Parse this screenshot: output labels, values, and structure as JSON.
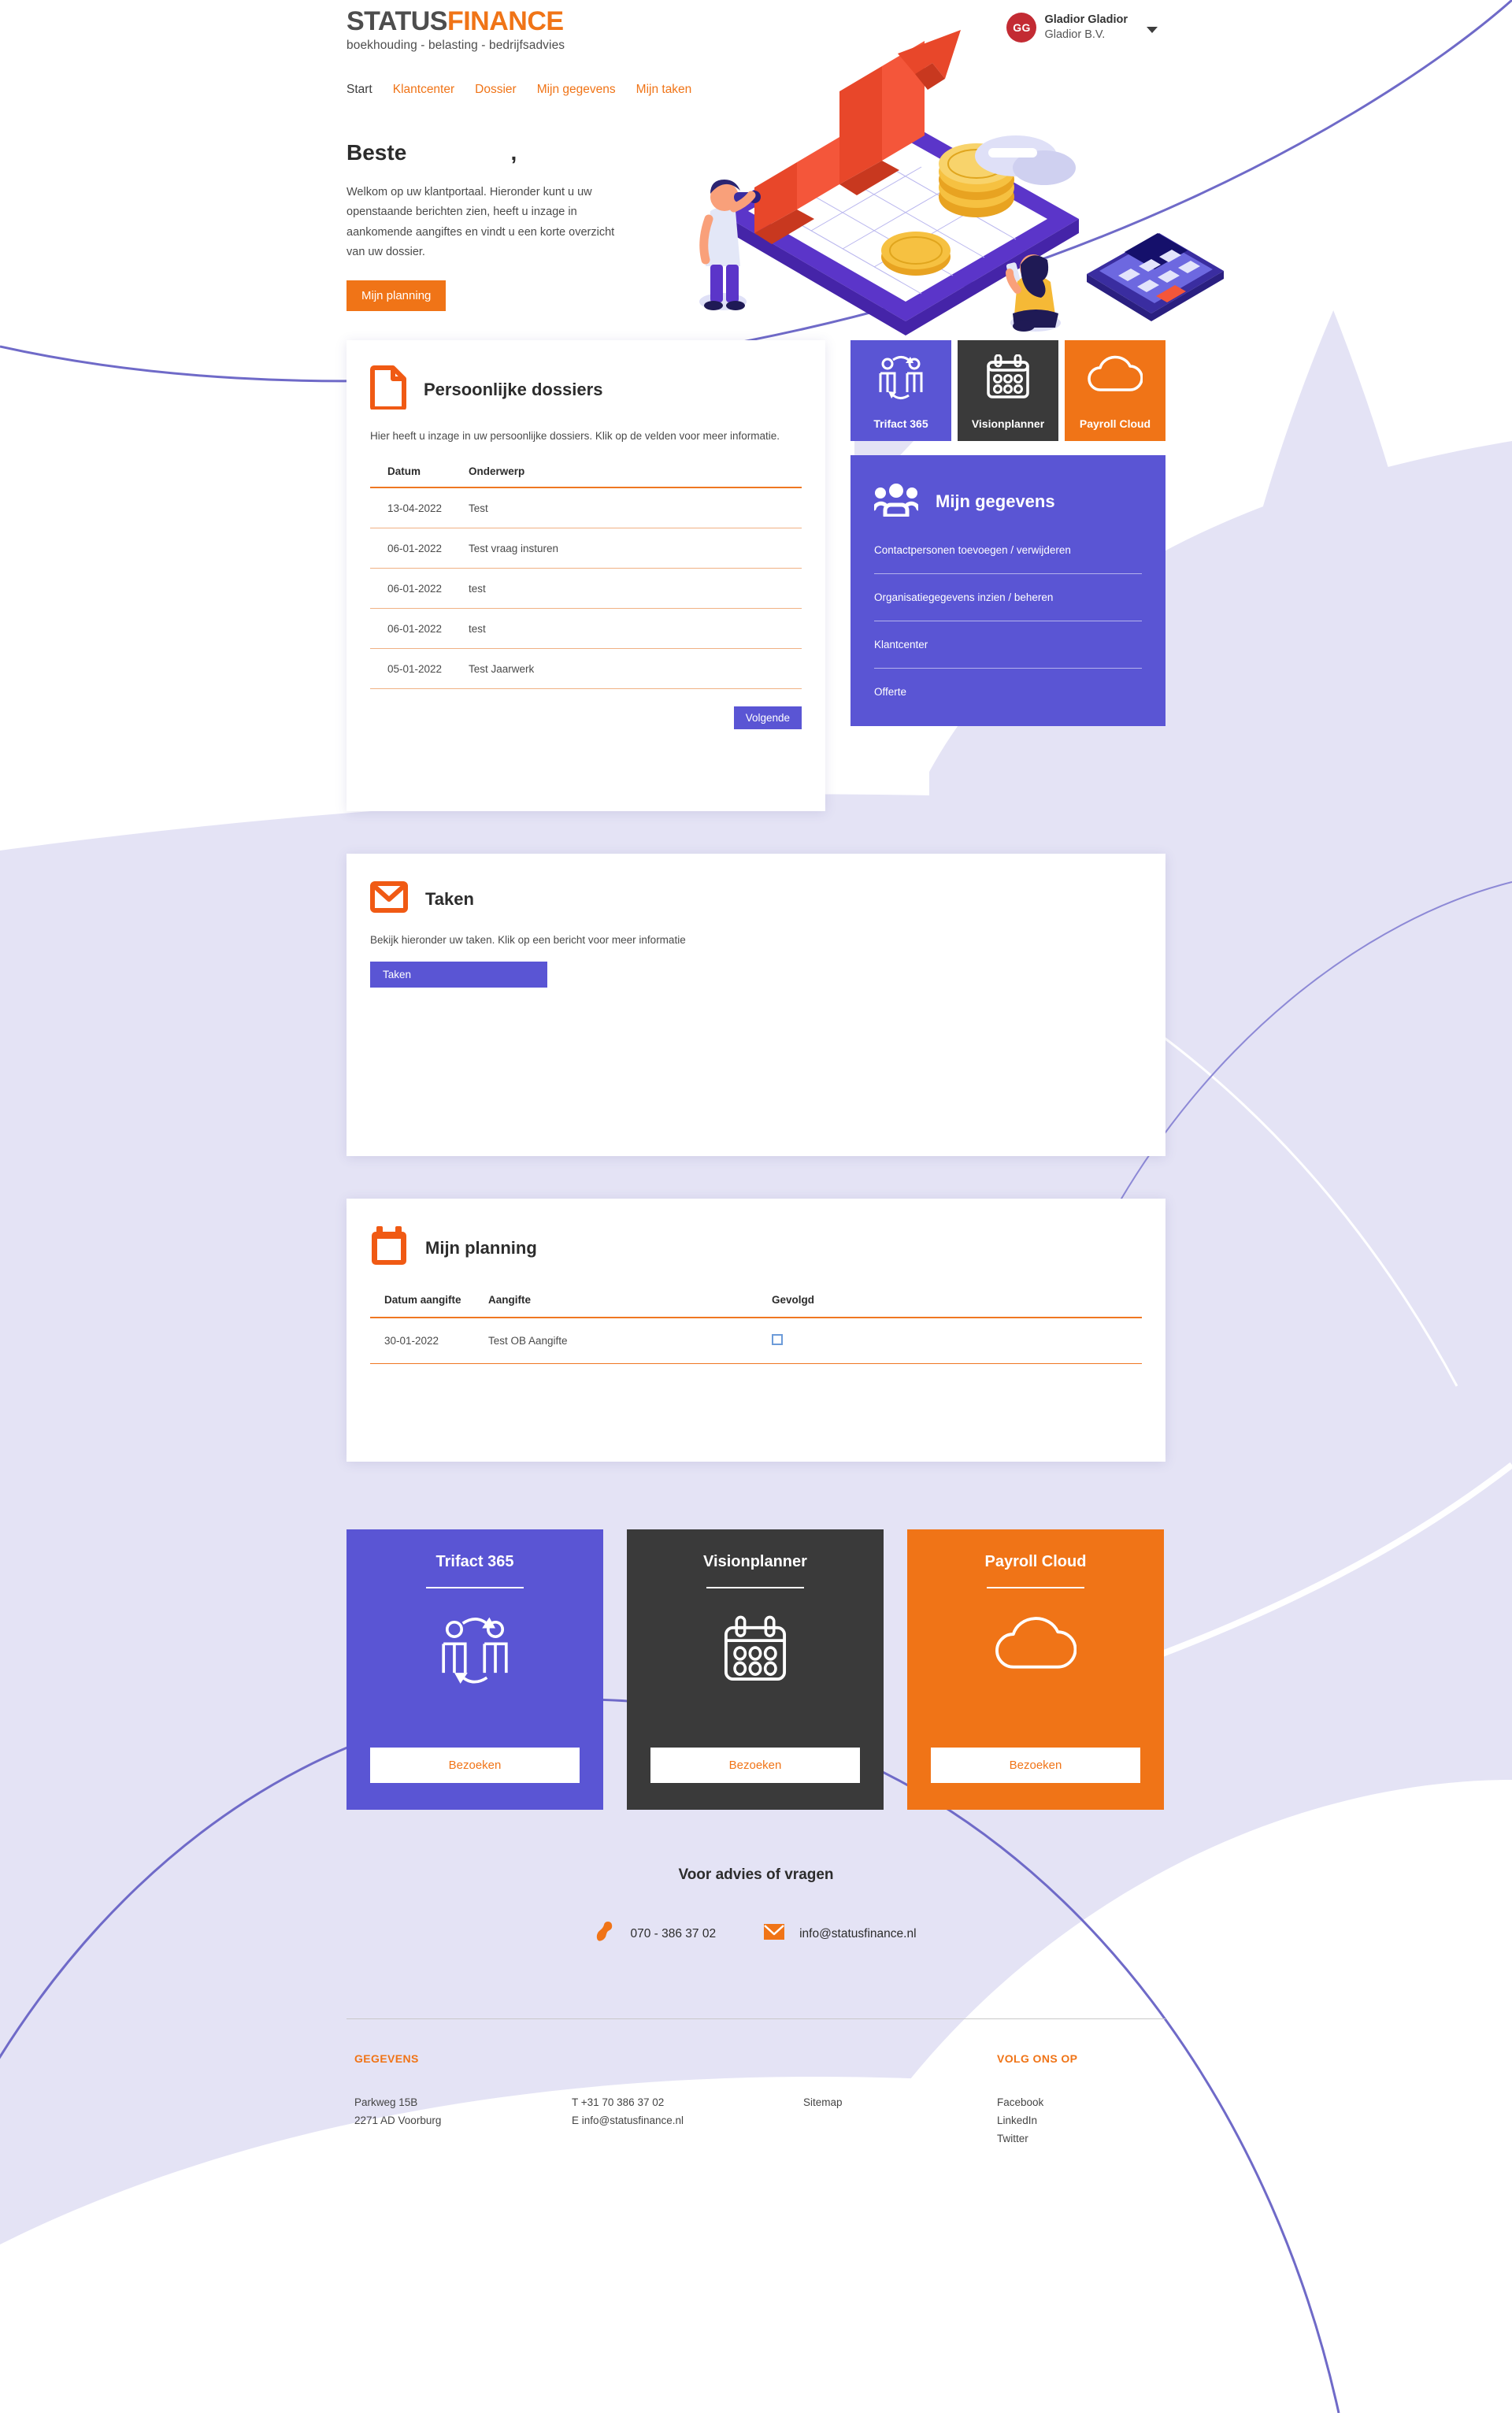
{
  "brand": {
    "logo_status": "STATUS",
    "logo_finance": "FINANCE",
    "tagline": "boekhouding - belasting - bedrijfsadvies",
    "accent_orange": "#f07417",
    "accent_purple": "#5a55d4",
    "accent_dark": "#3a3a3a",
    "avatar_red": "#c32b33"
  },
  "user": {
    "initials": "GG",
    "name": "Gladior Gladior",
    "organisation": "Gladior B.V."
  },
  "nav": {
    "items": [
      {
        "label": "Start",
        "active": true
      },
      {
        "label": "Klantcenter",
        "active": false
      },
      {
        "label": "Dossier",
        "active": false
      },
      {
        "label": "Mijn gegevens",
        "active": false
      },
      {
        "label": "Mijn taken",
        "active": false
      }
    ]
  },
  "hero": {
    "title": "Beste                 ,",
    "paragraph": "Welkom op uw klantportaal. Hieronder kunt u uw openstaande berichten zien, heeft u inzage in aankomende aangiftes en vindt u een korte overzicht van uw dossier.",
    "button": "Mijn planning"
  },
  "dossiers": {
    "icon": "document-icon",
    "title": "Persoonlijke dossiers",
    "description": "Hier heeft u inzage in uw persoonlijke dossiers. Klik op de velden voor meer informatie.",
    "columns": [
      "Datum",
      "Onderwerp"
    ],
    "rows": [
      {
        "datum": "13-04-2022",
        "onderwerp": "Test"
      },
      {
        "datum": "06-01-2022",
        "onderwerp": "Test vraag insturen"
      },
      {
        "datum": "06-01-2022",
        "onderwerp": "test"
      },
      {
        "datum": "06-01-2022",
        "onderwerp": "test"
      },
      {
        "datum": "05-01-2022",
        "onderwerp": "Test Jaarwerk"
      }
    ],
    "next_button": "Volgende"
  },
  "mini_tiles": [
    {
      "label": "Trifact 365",
      "icon": "people-exchange-icon",
      "theme": "purple"
    },
    {
      "label": "Visionplanner",
      "icon": "calendar-dots-icon",
      "theme": "dark"
    },
    {
      "label": "Payroll Cloud",
      "icon": "cloud-icon",
      "theme": "orange"
    }
  ],
  "gegevens": {
    "icon": "people-group-icon",
    "title": "Mijn gegevens",
    "items": [
      "Contactpersonen toevoegen / verwijderen",
      "Organisatiegegevens inzien / beheren",
      "Klantcenter",
      "Offerte"
    ]
  },
  "taken": {
    "icon": "envelope-icon",
    "title": "Taken",
    "description": "Bekijk hieronder uw taken. Klik op een bericht voor meer informatie",
    "button": "Taken"
  },
  "planning": {
    "icon": "calendar-icon",
    "title": "Mijn planning",
    "columns": [
      "Datum aangifte",
      "Aangifte",
      "Gevolgd"
    ],
    "rows": [
      {
        "datum": "30-01-2022",
        "aangifte": "Test OB Aangifte",
        "gevolgd": false
      }
    ]
  },
  "big_cards": [
    {
      "title": "Trifact 365",
      "icon": "people-exchange-icon",
      "button": "Bezoeken",
      "theme": "purple"
    },
    {
      "title": "Visionplanner",
      "icon": "calendar-dots-icon",
      "button": "Bezoeken",
      "theme": "dark"
    },
    {
      "title": "Payroll Cloud",
      "icon": "cloud-icon",
      "button": "Bezoeken",
      "theme": "orange"
    }
  ],
  "advies": {
    "title": "Voor advies of vragen",
    "phone_icon": "phone-icon",
    "phone": "070 - 386 37 02",
    "mail_icon": "envelope-filled-icon",
    "email": "info@statusfinance.nl"
  },
  "footer": {
    "col1_head": "GEGEVENS",
    "col1_lines": [
      "Parkweg 15B",
      "2271 AD Voorburg"
    ],
    "col2_lines": [
      "T +31 70 386 37 02",
      "E info@statusfinance.nl"
    ],
    "col3_links": [
      "Sitemap"
    ],
    "col4_head": "VOLG ONS OP",
    "col4_links": [
      "Facebook",
      "LinkedIn",
      "Twitter"
    ]
  }
}
